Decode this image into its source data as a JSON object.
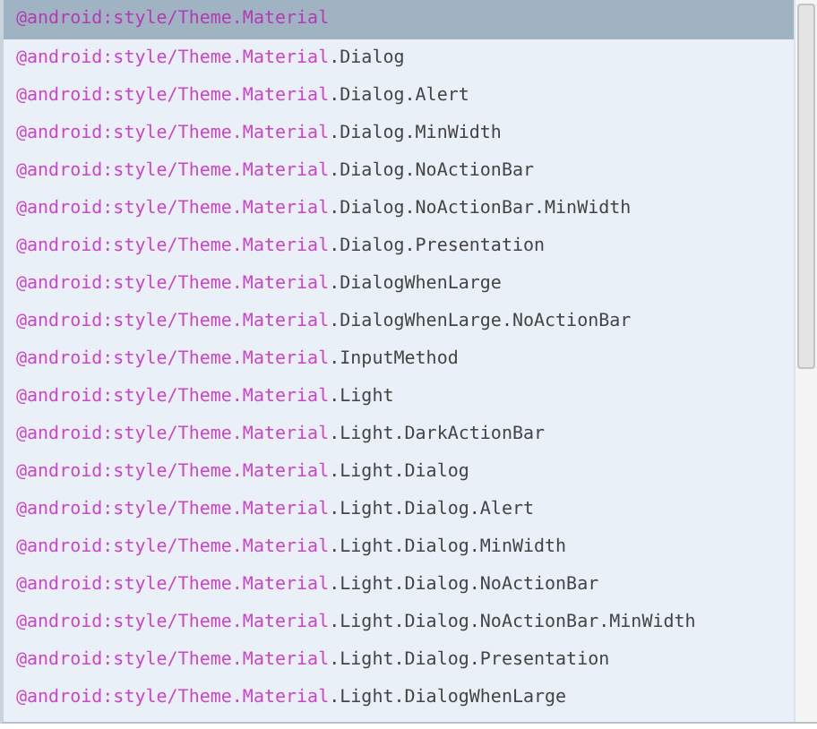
{
  "completion_list": {
    "items": [
      {
        "match": "@android:style/Theme.Material",
        "selected": true
      },
      {
        "match": "@android:style/Theme.Material",
        "rest": ".Dialog",
        "selected": false
      },
      {
        "match": "@android:style/Theme.Material",
        "rest": ".Dialog.Alert",
        "selected": false
      },
      {
        "match": "@android:style/Theme.Material",
        "rest": ".Dialog.MinWidth",
        "selected": false
      },
      {
        "match": "@android:style/Theme.Material",
        "rest": ".Dialog.NoActionBar",
        "selected": false
      },
      {
        "match": "@android:style/Theme.Material",
        "rest": ".Dialog.NoActionBar.MinWidth",
        "selected": false
      },
      {
        "match": "@android:style/Theme.Material",
        "rest": ".Dialog.Presentation",
        "selected": false
      },
      {
        "match": "@android:style/Theme.Material",
        "rest": ".DialogWhenLarge",
        "selected": false
      },
      {
        "match": "@android:style/Theme.Material",
        "rest": ".DialogWhenLarge.NoActionBar",
        "selected": false
      },
      {
        "match": "@android:style/Theme.Material",
        "rest": ".InputMethod",
        "selected": false
      },
      {
        "match": "@android:style/Theme.Material",
        "rest": ".Light",
        "selected": false
      },
      {
        "match": "@android:style/Theme.Material",
        "rest": ".Light.DarkActionBar",
        "selected": false
      },
      {
        "match": "@android:style/Theme.Material",
        "rest": ".Light.Dialog",
        "selected": false
      },
      {
        "match": "@android:style/Theme.Material",
        "rest": ".Light.Dialog.Alert",
        "selected": false
      },
      {
        "match": "@android:style/Theme.Material",
        "rest": ".Light.Dialog.MinWidth",
        "selected": false
      },
      {
        "match": "@android:style/Theme.Material",
        "rest": ".Light.Dialog.NoActionBar",
        "selected": false
      },
      {
        "match": "@android:style/Theme.Material",
        "rest": ".Light.Dialog.NoActionBar.MinWidth",
        "selected": false
      },
      {
        "match": "@android:style/Theme.Material",
        "rest": ".Light.Dialog.Presentation",
        "selected": false
      },
      {
        "match": "@android:style/Theme.Material",
        "rest": ".Light.DialogWhenLarge",
        "selected": false
      }
    ]
  }
}
